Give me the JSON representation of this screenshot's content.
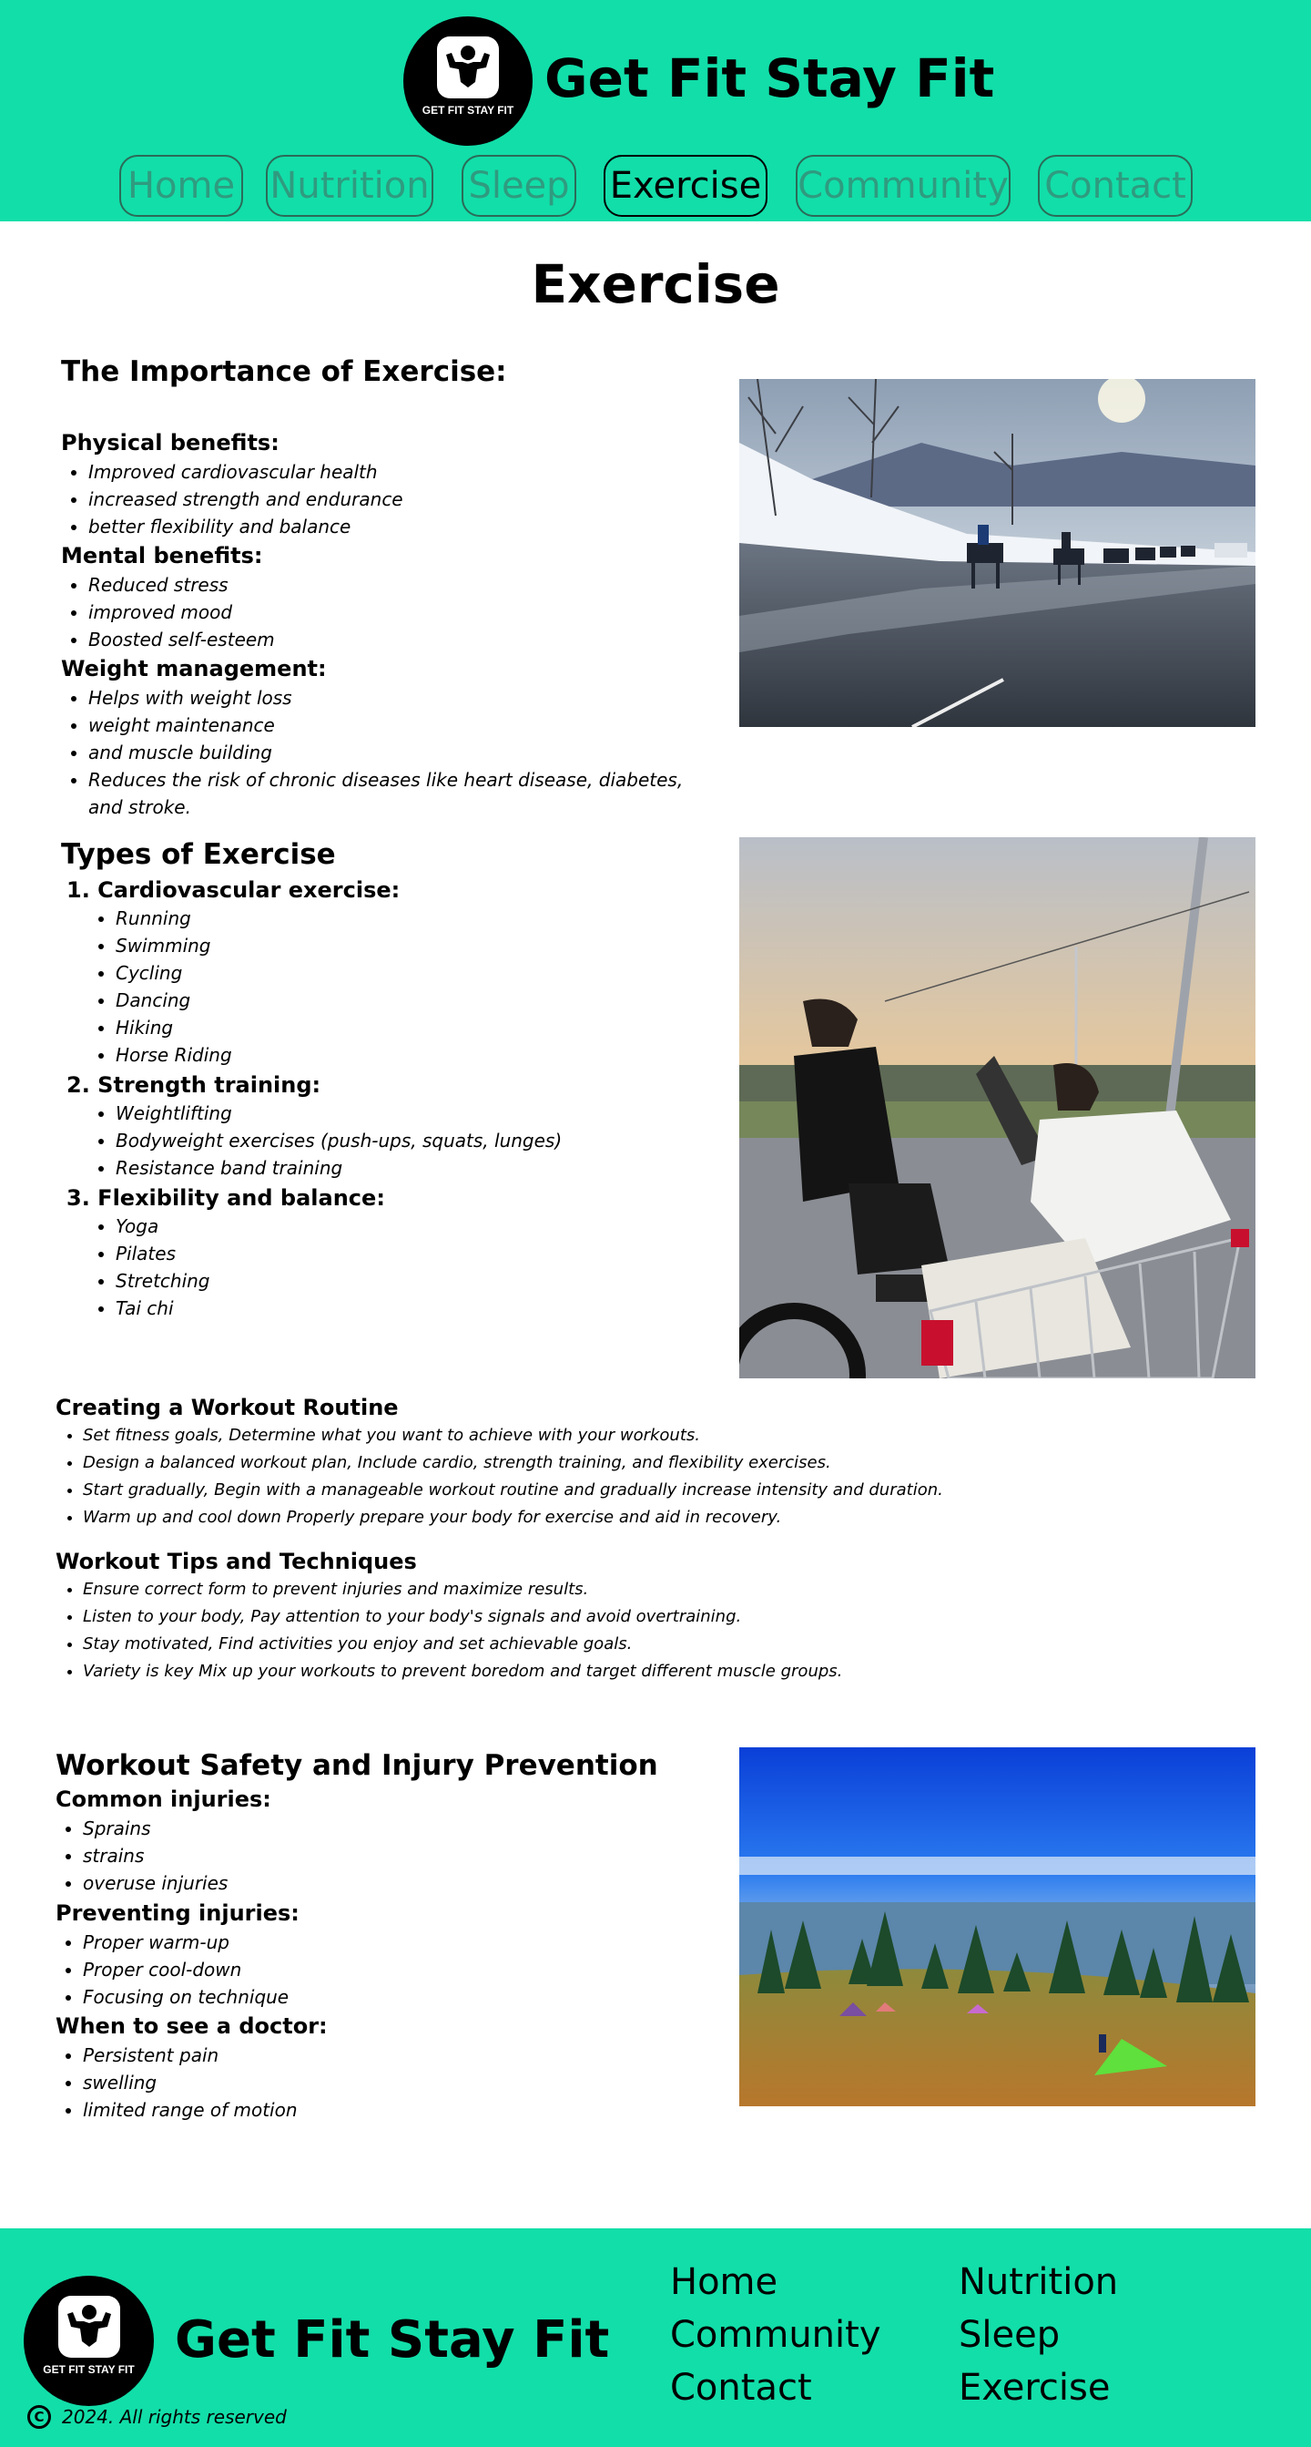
{
  "brand": {
    "name": "Get Fit Stay Fit",
    "logo_text": "GET FIT STAY FIT",
    "accent_color": "#12dea9"
  },
  "nav": {
    "items": [
      {
        "label": "Home"
      },
      {
        "label": "Nutrition"
      },
      {
        "label": "Sleep"
      },
      {
        "label": "Exercise",
        "active": true
      },
      {
        "label": "Community"
      },
      {
        "label": "Contact"
      }
    ]
  },
  "page_title": "Exercise",
  "importance": {
    "title": "The Importance of Exercise:",
    "physical_title": "Physical benefits:",
    "physical": [
      "Improved cardiovascular health",
      "increased strength and endurance",
      "better flexibility and balance"
    ],
    "mental_title": "Mental benefits:",
    "mental": [
      "Reduced stress",
      "improved mood",
      "Boosted self-esteem"
    ],
    "weight_title": "Weight management:",
    "weight": [
      "Helps with weight loss",
      " weight maintenance",
      "and muscle building",
      "Reduces the risk of chronic diseases like heart disease, diabetes, and stroke."
    ]
  },
  "types": {
    "title": "Types of Exercise",
    "cardio_title": "Cardiovascular exercise:",
    "cardio": [
      "Running",
      "Swimming",
      "Cycling",
      "Dancing",
      "Hiking",
      "Horse Riding"
    ],
    "strength_title": "Strength training:",
    "strength": [
      "Weightlifting",
      "Bodyweight exercises (push-ups, squats, lunges)",
      "Resistance band training"
    ],
    "flex_title": "Flexibility and balance:",
    "flex": [
      "Yoga",
      "Pilates",
      "Stretching",
      "Tai chi"
    ]
  },
  "routine": {
    "title": "Creating a Workout Routine",
    "items": [
      "Set fitness goals, Determine what you want to achieve with your workouts.",
      "Design a balanced workout plan, Include cardio, strength training, and flexibility exercises.",
      "Start gradually, Begin with a manageable workout routine and gradually increase intensity and duration.",
      "Warm up and cool down Properly prepare your body for exercise and aid in recovery."
    ]
  },
  "tips": {
    "title": "Workout Tips and Techniques",
    "items": [
      "Ensure correct form to prevent injuries and maximize results.",
      "Listen to your body, Pay attention to your body's signals and avoid overtraining.",
      "Stay motivated, Find activities you enjoy and set achievable goals.",
      "Variety is key Mix up your workouts to prevent boredom and target different muscle groups."
    ]
  },
  "safety": {
    "title": "Workout Safety and Injury Prevention",
    "common_title": "Common injuries:",
    "common": [
      " Sprains",
      "strains",
      "overuse injuries"
    ],
    "prevent_title": "Preventing injuries:",
    "prevent": [
      " Proper warm-up",
      " Proper cool-down",
      " Focusing on technique"
    ],
    "doctor_title": "When to see a doctor:",
    "doctor": [
      "Persistent pain",
      "swelling",
      "limited range of motion"
    ]
  },
  "footer": {
    "links_col1": [
      "Home",
      "Community",
      "Contact"
    ],
    "links_col2": [
      "Nutrition",
      "Sleep",
      "Exercise"
    ],
    "copyright": "2024. All rights reserved",
    "copyright_icon": "copyright-icon"
  }
}
